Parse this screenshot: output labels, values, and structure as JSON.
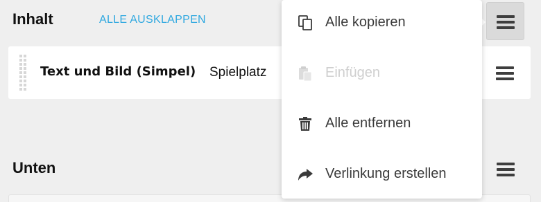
{
  "content_section": {
    "title": "Inhalt",
    "expand_all_label": "ALLE AUSKLAPPEN"
  },
  "block": {
    "type_label": "Text und Bild (Simpel)",
    "name": "Spielplatz"
  },
  "bottom_section": {
    "title": "Unten"
  },
  "dropdown": {
    "items": [
      {
        "label": "Alle kopieren",
        "icon": "copy-icon",
        "enabled": true
      },
      {
        "label": "Einfügen",
        "icon": "paste-icon",
        "enabled": false
      },
      {
        "label": "Alle entfernen",
        "icon": "trash-icon",
        "enabled": true
      },
      {
        "label": "Verlinkung erstellen",
        "icon": "share-link-icon",
        "enabled": true
      }
    ]
  },
  "colors": {
    "accent": "#2fa8e0",
    "background": "#efefef",
    "menu_text": "#3a3a3a",
    "disabled_text": "#cfcfcf"
  }
}
